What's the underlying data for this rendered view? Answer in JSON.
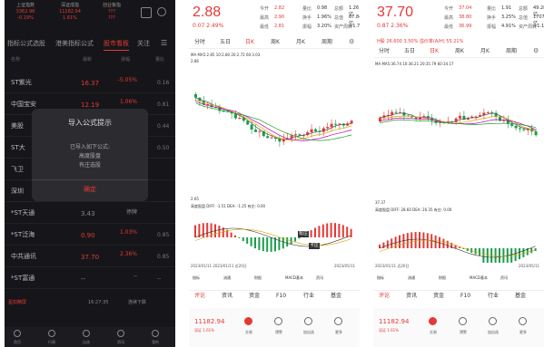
{
  "p1": {
    "indices": [
      {
        "name": "上证指数",
        "value": "3362.98",
        "chg": "-0.19%",
        "color": "#e53935"
      },
      {
        "name": "深证成指",
        "value": "11182.94",
        "chg": "1.61%",
        "color": "#e53935"
      },
      {
        "name": "创业板指",
        "value": "???",
        "chg": "???",
        "color": "#e53935"
      }
    ],
    "tabs": [
      "指标公式选股",
      "港美指标公式",
      "股市看板",
      "关注"
    ],
    "header": [
      "名称",
      "最新",
      "涨幅",
      "量比"
    ],
    "rows": [
      {
        "name": "ST紫光",
        "code": "",
        "price": "16.37",
        "chg": "-5.05%",
        "chg2": "",
        "vol": "0.16",
        "pc": "#e53935",
        "cc": "#e53935"
      },
      {
        "name": "中国宝安",
        "code": "",
        "price": "12.19",
        "chg": "1.06%",
        "chg2": "",
        "vol": "0.81",
        "pc": "#e53935",
        "cc": "#e53935"
      },
      {
        "name": "美股",
        "code": "",
        "price": "",
        "chg": "",
        "chg2": "",
        "vol": "0.44",
        "pc": "#e53935",
        "cc": "#e53935"
      },
      {
        "name": "ST大",
        "code": "",
        "price": "",
        "chg": "",
        "chg2": "",
        "vol": "0.50",
        "pc": "#e53935",
        "cc": "#e53935"
      },
      {
        "name": "飞卫",
        "code": "",
        "price": "",
        "chg": "",
        "chg2": "",
        "vol": "",
        "pc": "#e53935",
        "cc": "#e53935"
      },
      {
        "name": "深圳",
        "code": "",
        "price": "",
        "chg": "",
        "chg2": "",
        "vol": "",
        "pc": "#e53935",
        "cc": "#e53935"
      },
      {
        "name": "*ST天通",
        "code": "",
        "price": "3.43",
        "chg": "停牌",
        "chg2": "",
        "vol": "",
        "pc": "#888",
        "cc": "#888"
      },
      {
        "name": "*ST泛海",
        "code": "",
        "price": "0.90",
        "chg": "1.03%",
        "chg2": "",
        "vol": "0.85",
        "pc": "#e53935",
        "cc": "#e53935"
      },
      {
        "name": "中共通讯",
        "code": "",
        "price": "37.70",
        "chg": "2.36%",
        "chg2": "",
        "vol": "0.85",
        "pc": "#e53935",
        "cc": "#e53935"
      },
      {
        "name": "*ST富通",
        "code": "",
        "price": "--",
        "chg": "--",
        "chg2": "",
        "vol": "--",
        "pc": "#888",
        "cc": "#888"
      }
    ],
    "footer_left": "盈扣精屏",
    "footer_time": "16:27:35",
    "footer_right": "连续下跌",
    "modal": {
      "title": "导入公式提示",
      "line1": "已导入如下公式:",
      "line2": "高度股盘",
      "line3": "有庄选股",
      "confirm": "确定"
    },
    "nav": [
      "首页",
      "行情",
      "自选",
      "资讯",
      "我的"
    ]
  },
  "p2": {
    "price": "2.88",
    "chg": "0.07 2.49%",
    "stats": [
      [
        "今开",
        "2.82"
      ],
      [
        "最高",
        "2.90"
      ],
      [
        "最低",
        "2.81"
      ],
      [
        "量比",
        "0.98"
      ],
      [
        "换手",
        "1.96%"
      ],
      [
        "振幅",
        "3.20%"
      ],
      [
        "总额",
        "1.26亿"
      ],
      [
        "总值",
        "67.84亿"
      ],
      [
        "资产周转",
        "+1.71%"
      ]
    ],
    "tabs": [
      "分时",
      "五日",
      "日K",
      "周K",
      "月K",
      "周期"
    ],
    "ma": "MA MA5:2.85 10:2.80 20:2.72 60:3.03",
    "ind": "高度股盘 DIFF: -1.51 DEA: -1.25 有庄: 0.00",
    "annot1": "有庄",
    "annot2": "卡庄",
    "ylow": "2.65",
    "yhigh": "2.86",
    "dateL": "2023/01/11 2023/01/11 近20日",
    "dateR": "2023/05/11",
    "btns": [
      "指标",
      "流通",
      "财报",
      "MACD基本",
      "资讯"
    ],
    "ftabs": [
      "评论",
      "资讯",
      "资金",
      "F10",
      "行业",
      "基金"
    ],
    "fbar": {
      "idx": "11182.94",
      "idxchg": "深证 1.61%",
      "items": [
        "交易",
        "预警",
        "加自选",
        "更多"
      ]
    }
  },
  "p3": {
    "price": "37.70",
    "chg": "0.87 2.36%",
    "stats": [
      [
        "今开",
        "37.04"
      ],
      [
        "最高",
        "38.80"
      ],
      [
        "最低",
        "36.99"
      ],
      [
        "量比",
        "1.91"
      ],
      [
        "换手",
        "3.25%"
      ],
      [
        "振幅",
        "4.91%"
      ],
      [
        "总额",
        "49.28亿"
      ],
      [
        "总值",
        "1707亿"
      ],
      [
        "资产周转",
        "+1.12%"
      ]
    ],
    "hk": "H股 26.600 3.50% 溢价率(A/H) 55.21%",
    "tabs": [
      "分时",
      "五日",
      "日K",
      "周K",
      "月K",
      "周期"
    ],
    "ma": "MA MA5:36.74 10:36.21 20:35.79 60:34.17",
    "ind": "高度股盘 DIFF: 28.60 DEA: 26.35 有庄: 0.00",
    "ylow": "37.37",
    "dateL": "2023/01/11 近20日",
    "dateR": "2023/05/11",
    "btns": [
      "指标",
      "流通",
      "财报",
      "MACD基本",
      "资讯"
    ],
    "ftabs": [
      "评论",
      "资讯",
      "资金",
      "F10",
      "行业",
      "基金"
    ],
    "fbar": {
      "idx": "11182.94",
      "idxchg": "深证 1.61%",
      "items": [
        "交易",
        "预警",
        "加自选",
        "更多"
      ]
    }
  },
  "colors": {
    "up": "#e53935",
    "down": "#1a9e4b",
    "dark": "#16161a"
  }
}
